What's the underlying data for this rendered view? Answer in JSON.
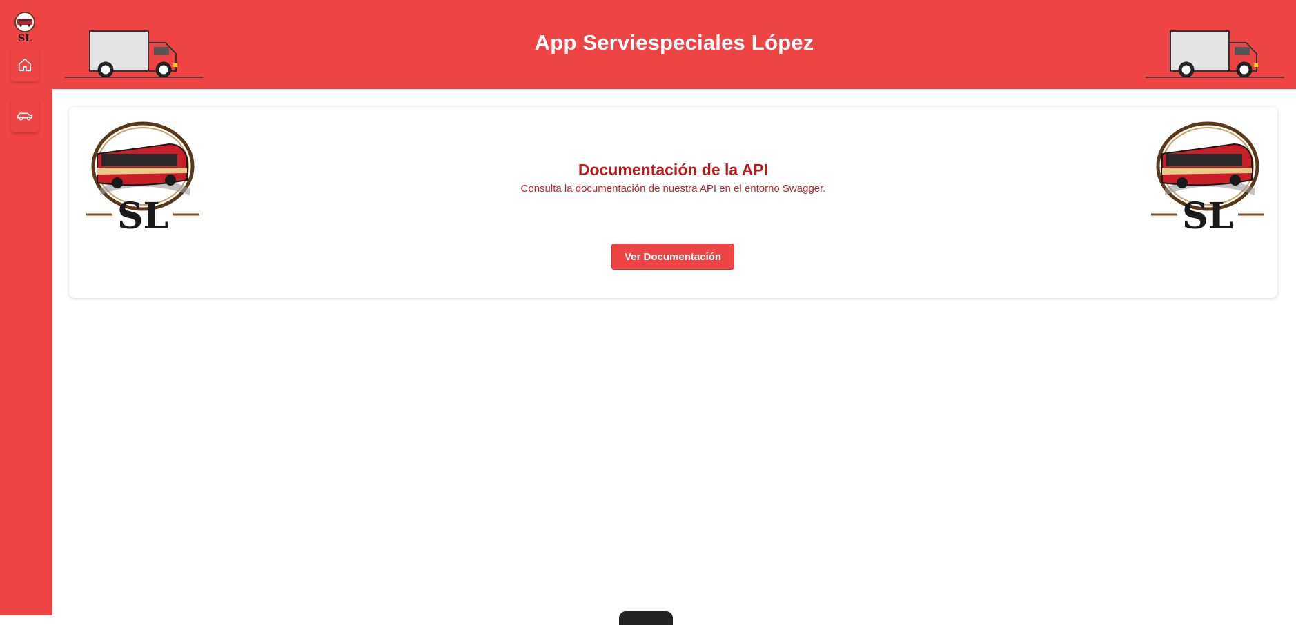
{
  "header": {
    "title": "App Serviespeciales López"
  },
  "sidebar": {
    "logo_text": "SL",
    "items": [
      {
        "icon": "home-icon"
      },
      {
        "icon": "car-icon"
      }
    ]
  },
  "card": {
    "logo_text": "SL",
    "title": "Documentación de la API",
    "subtitle": "Consulta la documentación de nuestra API en el entorno Swagger.",
    "button_label": "Ver Documentación"
  },
  "colors": {
    "primary": "#ef4444",
    "title_red": "#b91c1c",
    "background": "#ffffff"
  }
}
